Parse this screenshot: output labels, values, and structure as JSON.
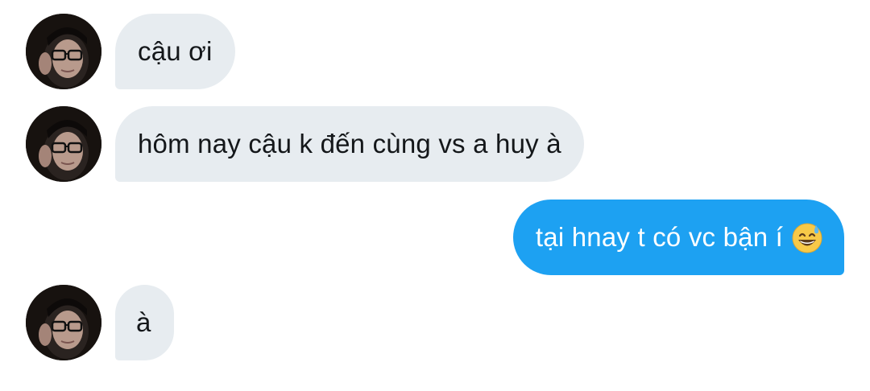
{
  "conversation": {
    "messages": [
      {
        "direction": "incoming",
        "text": "cậu ơi"
      },
      {
        "direction": "incoming",
        "text": "hôm nay cậu k đến cùng vs a huy à"
      },
      {
        "direction": "outgoing",
        "text": "tại hnay t có vc bận í",
        "emoji": "grinning-face-with-sweat-icon"
      },
      {
        "direction": "incoming",
        "text": "à"
      }
    ]
  },
  "colors": {
    "incoming_bubble": "#e7ecf0",
    "outgoing_bubble": "#1da1f2",
    "incoming_text": "#14171a",
    "outgoing_text": "#ffffff"
  },
  "icons": {
    "avatar": "user-avatar-icon",
    "emoji": "grinning-face-with-sweat-icon"
  }
}
